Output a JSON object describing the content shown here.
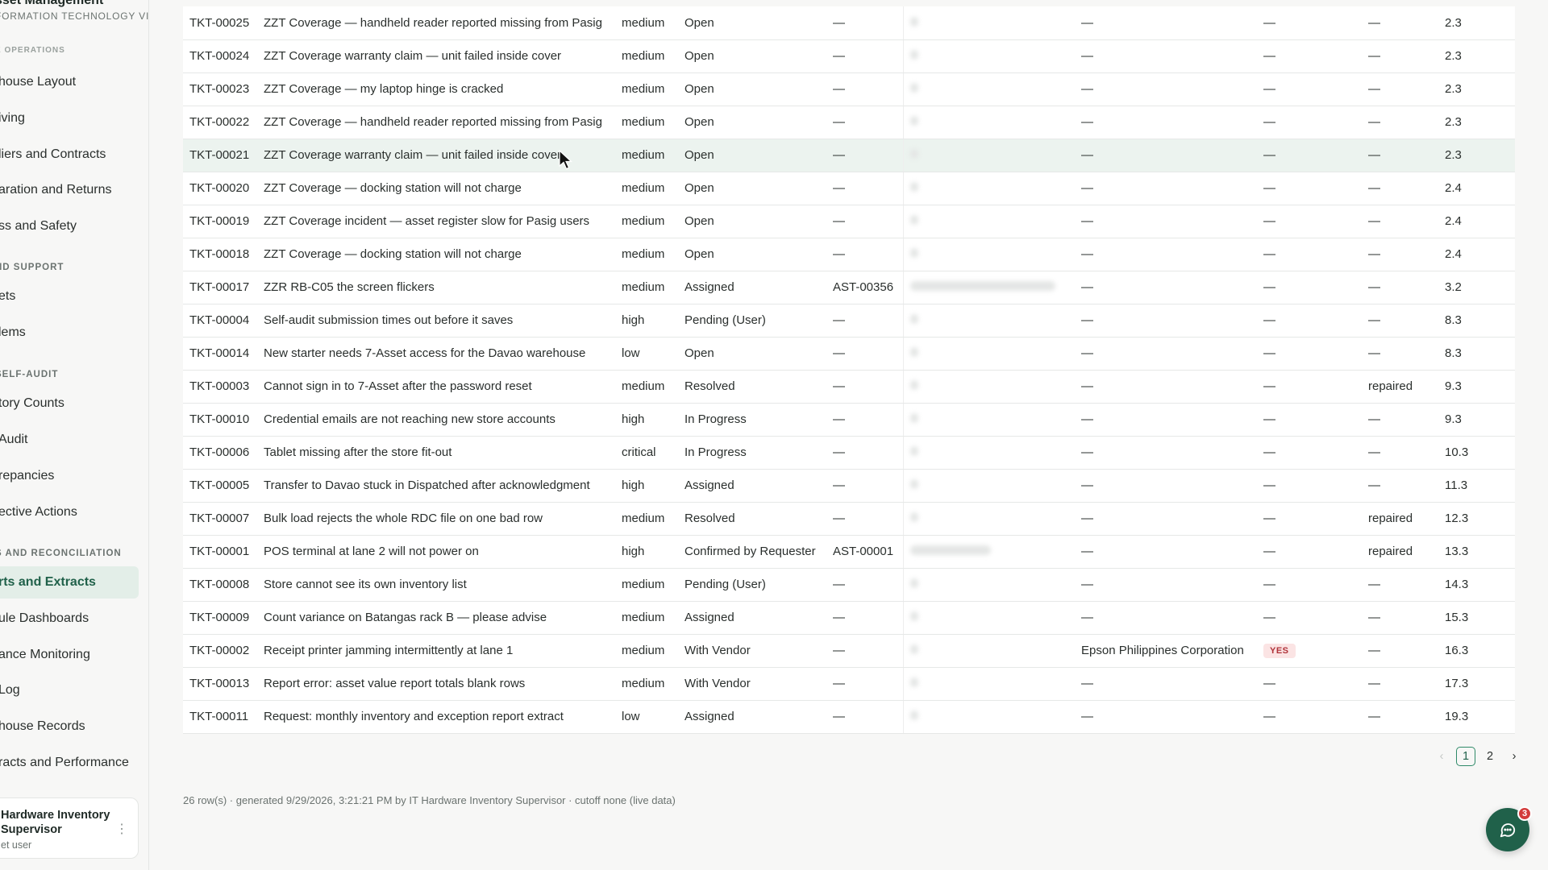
{
  "sidebar": {
    "brand_title": "sset Management",
    "brand_sub": "FORMATION TECHNOLOGY VISION",
    "section_top_partial": "E OPERATIONS",
    "items_top": [
      "house Layout",
      "iving",
      "liers and Contracts",
      "aration and Returns",
      "ss and Safety"
    ],
    "section_support": "ND SUPPORT",
    "items_support": [
      "ets",
      "lems"
    ],
    "section_audit": "SELF-AUDIT",
    "items_audit": [
      "tory Counts",
      "Audit",
      "repancies",
      "ective Actions"
    ],
    "section_reports": "S AND RECONCILIATION",
    "items_reports": [
      "rts and Extracts",
      "ule Dashboards",
      "ance Monitoring",
      "Log",
      "house Records",
      "racts and Performance"
    ],
    "user_name": "Hardware Inventory Supervisor",
    "user_role": "et user",
    "user_menu_icon": "⋮"
  },
  "empty_mark": "—",
  "rows": [
    {
      "id": "TKT-00025",
      "title": "ZZT Coverage — handheld reader reported missing from Pasig",
      "priority": "medium",
      "status": "Open",
      "asset": "—",
      "vendor": "—",
      "flag": "—",
      "outcome": "—",
      "age": "2.3"
    },
    {
      "id": "TKT-00024",
      "title": "ZZT Coverage warranty claim — unit failed inside cover",
      "priority": "medium",
      "status": "Open",
      "asset": "—",
      "vendor": "—",
      "flag": "—",
      "outcome": "—",
      "age": "2.3"
    },
    {
      "id": "TKT-00023",
      "title": "ZZT Coverage — my laptop hinge is cracked",
      "priority": "medium",
      "status": "Open",
      "asset": "—",
      "vendor": "—",
      "flag": "—",
      "outcome": "—",
      "age": "2.3"
    },
    {
      "id": "TKT-00022",
      "title": "ZZT Coverage — handheld reader reported missing from Pasig",
      "priority": "medium",
      "status": "Open",
      "asset": "—",
      "vendor": "—",
      "flag": "—",
      "outcome": "—",
      "age": "2.3"
    },
    {
      "id": "TKT-00021",
      "title": "ZZT Coverage warranty claim — unit failed inside cover",
      "priority": "medium",
      "status": "Open",
      "asset": "—",
      "vendor": "—",
      "flag": "—",
      "outcome": "—",
      "age": "2.3",
      "hover": true
    },
    {
      "id": "TKT-00020",
      "title": "ZZT Coverage — docking station will not charge",
      "priority": "medium",
      "status": "Open",
      "asset": "—",
      "vendor": "—",
      "flag": "—",
      "outcome": "—",
      "age": "2.4"
    },
    {
      "id": "TKT-00019",
      "title": "ZZT Coverage incident — asset register slow for Pasig users",
      "priority": "medium",
      "status": "Open",
      "asset": "—",
      "vendor": "—",
      "flag": "—",
      "outcome": "—",
      "age": "2.4"
    },
    {
      "id": "TKT-00018",
      "title": "ZZT Coverage — docking station will not charge",
      "priority": "medium",
      "status": "Open",
      "asset": "—",
      "vendor": "—",
      "flag": "—",
      "outcome": "—",
      "age": "2.4"
    },
    {
      "id": "TKT-00017",
      "title": "ZZR RB-C05 the screen flickers",
      "priority": "medium",
      "status": "Assigned",
      "asset": "AST-00356",
      "vendor": "—",
      "flag": "—",
      "outcome": "—",
      "age": "3.2",
      "blur_wide": true
    },
    {
      "id": "TKT-00004",
      "title": "Self-audit submission times out before it saves",
      "priority": "high",
      "status": "Pending (User)",
      "asset": "—",
      "vendor": "—",
      "flag": "—",
      "outcome": "—",
      "age": "8.3"
    },
    {
      "id": "TKT-00014",
      "title": "New starter needs 7-Asset access for the Davao warehouse",
      "priority": "low",
      "status": "Open",
      "asset": "—",
      "vendor": "—",
      "flag": "—",
      "outcome": "—",
      "age": "8.3"
    },
    {
      "id": "TKT-00003",
      "title": "Cannot sign in to 7-Asset after the password reset",
      "priority": "medium",
      "status": "Resolved",
      "asset": "—",
      "vendor": "—",
      "flag": "—",
      "outcome": "repaired",
      "age": "9.3"
    },
    {
      "id": "TKT-00010",
      "title": "Credential emails are not reaching new store accounts",
      "priority": "high",
      "status": "In Progress",
      "asset": "—",
      "vendor": "—",
      "flag": "—",
      "outcome": "—",
      "age": "9.3"
    },
    {
      "id": "TKT-00006",
      "title": "Tablet missing after the store fit-out",
      "priority": "critical",
      "status": "In Progress",
      "asset": "—",
      "vendor": "—",
      "flag": "—",
      "outcome": "—",
      "age": "10.3"
    },
    {
      "id": "TKT-00005",
      "title": "Transfer to Davao stuck in Dispatched after acknowledgment",
      "priority": "high",
      "status": "Assigned",
      "asset": "—",
      "vendor": "—",
      "flag": "—",
      "outcome": "—",
      "age": "11.3"
    },
    {
      "id": "TKT-00007",
      "title": "Bulk load rejects the whole RDC file on one bad row",
      "priority": "medium",
      "status": "Resolved",
      "asset": "—",
      "vendor": "—",
      "flag": "—",
      "outcome": "repaired",
      "age": "12.3"
    },
    {
      "id": "TKT-00001",
      "title": "POS terminal at lane 2 will not power on",
      "priority": "high",
      "status": "Confirmed by Requester",
      "asset": "AST-00001",
      "vendor": "—",
      "flag": "—",
      "outcome": "repaired",
      "age": "13.3",
      "blur_mid": true
    },
    {
      "id": "TKT-00008",
      "title": "Store cannot see its own inventory list",
      "priority": "medium",
      "status": "Pending (User)",
      "asset": "—",
      "vendor": "—",
      "flag": "—",
      "outcome": "—",
      "age": "14.3"
    },
    {
      "id": "TKT-00009",
      "title": "Count variance on Batangas rack B — please advise",
      "priority": "medium",
      "status": "Assigned",
      "asset": "—",
      "vendor": "—",
      "flag": "—",
      "outcome": "—",
      "age": "15.3"
    },
    {
      "id": "TKT-00002",
      "title": "Receipt printer jamming intermittently at lane 1",
      "priority": "medium",
      "status": "With Vendor",
      "asset": "—",
      "vendor": "Epson Philippines Corporation",
      "flag": "YES",
      "outcome": "—",
      "age": "16.3"
    },
    {
      "id": "TKT-00013",
      "title": "Report error: asset value report totals blank rows",
      "priority": "medium",
      "status": "With Vendor",
      "asset": "—",
      "vendor": "—",
      "flag": "—",
      "outcome": "—",
      "age": "17.3"
    },
    {
      "id": "TKT-00011",
      "title": "Request: monthly inventory and exception report extract",
      "priority": "low",
      "status": "Assigned",
      "asset": "—",
      "vendor": "—",
      "flag": "—",
      "outcome": "—",
      "age": "19.3"
    }
  ],
  "pagination": {
    "prev": "‹",
    "pages": [
      "1",
      "2"
    ],
    "current": "1",
    "next": "›"
  },
  "footer_note": "26 row(s) · generated 9/29/2026, 3:21:21 PM by IT Hardware Inventory Supervisor · cutoff none (live data)",
  "chat": {
    "badge": "3"
  },
  "colors": {
    "accent": "#20614a",
    "active_bg": "#e3eee8",
    "badge_red": "#d33b3b"
  }
}
